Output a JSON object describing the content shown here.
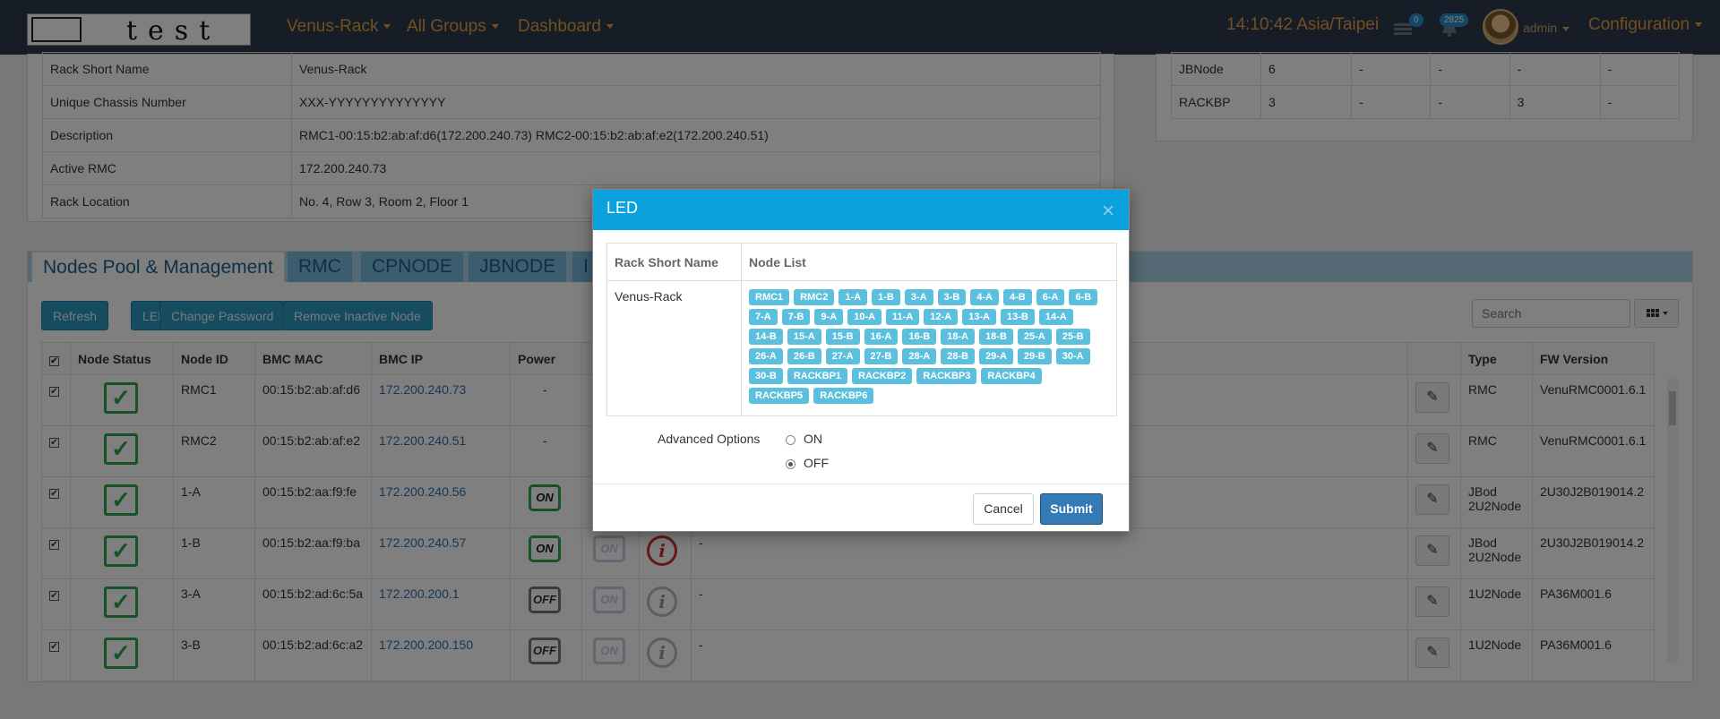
{
  "navbar": {
    "logo_text": "test",
    "menus": [
      "Venus-Rack",
      "All Groups",
      "Dashboard"
    ],
    "time": "14:10:42 Asia/Taipei",
    "messages_badge": "0",
    "alerts_badge": "2825",
    "user": "admin",
    "config": "Configuration"
  },
  "rack_info": {
    "rows": [
      {
        "key": "Rack Short Name",
        "value": "Venus-Rack"
      },
      {
        "key": "Unique Chassis Number",
        "value": "XXX-YYYYYYYYYYYYYY"
      },
      {
        "key": "Description",
        "value": "RMC1-00:15:b2:ab:af:d6(172.200.240.73) RMC2-00:15:b2:ab:af:e2(172.200.240.51)"
      },
      {
        "key": "Active RMC",
        "value": "172.200.240.73"
      },
      {
        "key": "Rack Location",
        "value": "No. 4, Row 3, Room 2, Floor 1"
      }
    ]
  },
  "summary": {
    "rows": [
      {
        "name": "JBNode",
        "c1": "6",
        "c2": "-",
        "c3": "-",
        "c4": "-",
        "c5": "-"
      },
      {
        "name": "RACKBP",
        "c1": "3",
        "c2": "-",
        "c3": "-",
        "c4": "3",
        "c5": "-"
      }
    ]
  },
  "nodes": {
    "tabs": [
      "Nodes Pool & Management",
      "RMC",
      "CPNODE",
      "JBNODE",
      "I"
    ],
    "buttons": {
      "refresh": "Refresh",
      "led": "LED",
      "change_password": "Change Password",
      "remove_inactive": "Remove Inactive Node"
    },
    "search_placeholder": "Search",
    "headers": {
      "status": "Node Status",
      "id": "Node ID",
      "mac": "BMC MAC",
      "ip": "BMC IP",
      "power": "Power",
      "type": "Type",
      "fw": "FW Version"
    },
    "rows": [
      {
        "id": "RMC1",
        "mac": "00:15:b2:ab:af:d6",
        "ip": "172.200.240.73",
        "power": "-",
        "desc": "",
        "type": "RMC",
        "fw": "VenuRMC0001.6.1"
      },
      {
        "id": "RMC2",
        "mac": "00:15:b2:ab:af:e2",
        "ip": "172.200.240.51",
        "power": "-",
        "desc": "",
        "type": "RMC",
        "fw": "VenuRMC0001.6.1"
      },
      {
        "id": "1-A",
        "mac": "00:15:b2:aa:f9:fe",
        "ip": "172.200.240.56",
        "power": "ON",
        "desc": "",
        "type": "JBod 2U2Node",
        "fw": "2U30J2B019014.2"
      },
      {
        "id": "1-B",
        "mac": "00:15:b2:aa:f9:ba",
        "ip": "172.200.240.57",
        "power": "ON",
        "uid": "ON",
        "desc": "-",
        "type": "JBod 2U2Node",
        "fw": "2U30J2B019014.2"
      },
      {
        "id": "3-A",
        "mac": "00:15:b2:ad:6c:5a",
        "ip": "172.200.200.1",
        "power": "OFF",
        "uid": "ON",
        "desc": "-",
        "type": "1U2Node",
        "fw": "PA36M001.6"
      },
      {
        "id": "3-B",
        "mac": "00:15:b2:ad:6c:a2",
        "ip": "172.200.200.150",
        "power": "OFF",
        "uid": "ON",
        "desc": "-",
        "type": "1U2Node",
        "fw": "PA36M001.6"
      }
    ]
  },
  "modal": {
    "title": "LED",
    "close": "×",
    "col_rack": "Rack Short Name",
    "col_nodes": "Node List",
    "rack_name": "Venus-Rack",
    "node_list": [
      "RMC1",
      "RMC2",
      "1-A",
      "1-B",
      "3-A",
      "3-B",
      "4-A",
      "4-B",
      "6-A",
      "6-B",
      "7-A",
      "7-B",
      "9-A",
      "10-A",
      "11-A",
      "12-A",
      "13-A",
      "13-B",
      "14-A",
      "14-B",
      "15-A",
      "15-B",
      "16-A",
      "16-B",
      "18-A",
      "18-B",
      "25-A",
      "25-B",
      "26-A",
      "26-B",
      "27-A",
      "27-B",
      "28-A",
      "28-B",
      "29-A",
      "29-B",
      "30-A",
      "30-B",
      "RACKBP1",
      "RACKBP2",
      "RACKBP3",
      "RACKBP4",
      "RACKBP5",
      "RACKBP6"
    ],
    "advanced_label": "Advanced Options",
    "option_on": "ON",
    "option_off": "OFF",
    "cancel": "Cancel",
    "submit": "Submit"
  }
}
